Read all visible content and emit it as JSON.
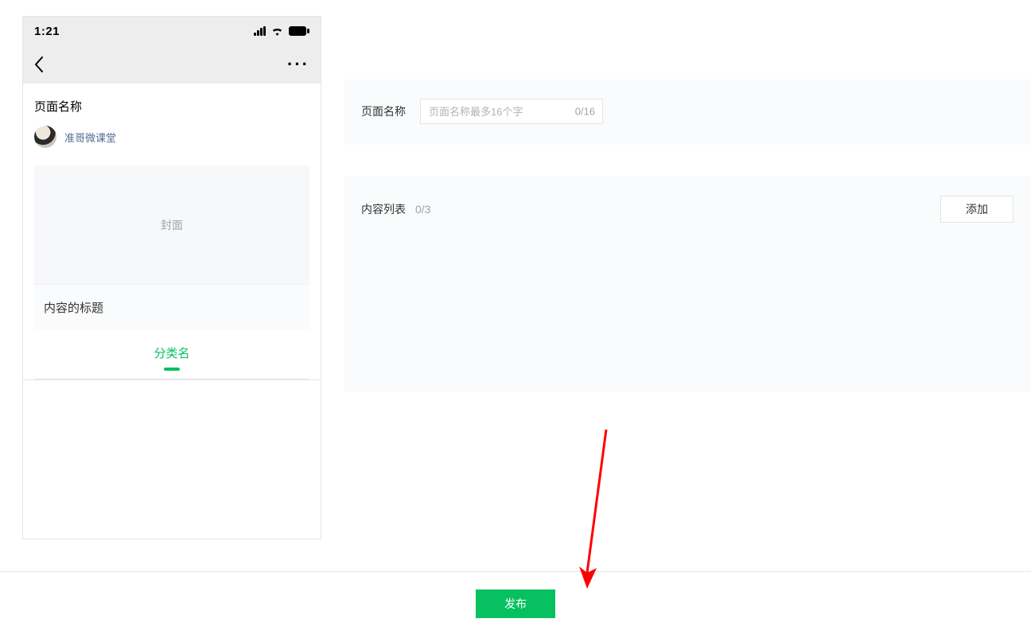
{
  "preview": {
    "status_time": "1:21",
    "page_name_label": "页面名称",
    "author_name": "准哥微课堂",
    "cover_placeholder": "封面",
    "content_title": "内容的标题",
    "category_tab": "分类名"
  },
  "form": {
    "page_name": {
      "label": "页面名称",
      "placeholder": "页面名称最多16个字",
      "counter": "0/16"
    },
    "content_list": {
      "label": "内容列表",
      "counter": "0/3",
      "add_button": "添加"
    }
  },
  "footer": {
    "publish": "发布"
  }
}
